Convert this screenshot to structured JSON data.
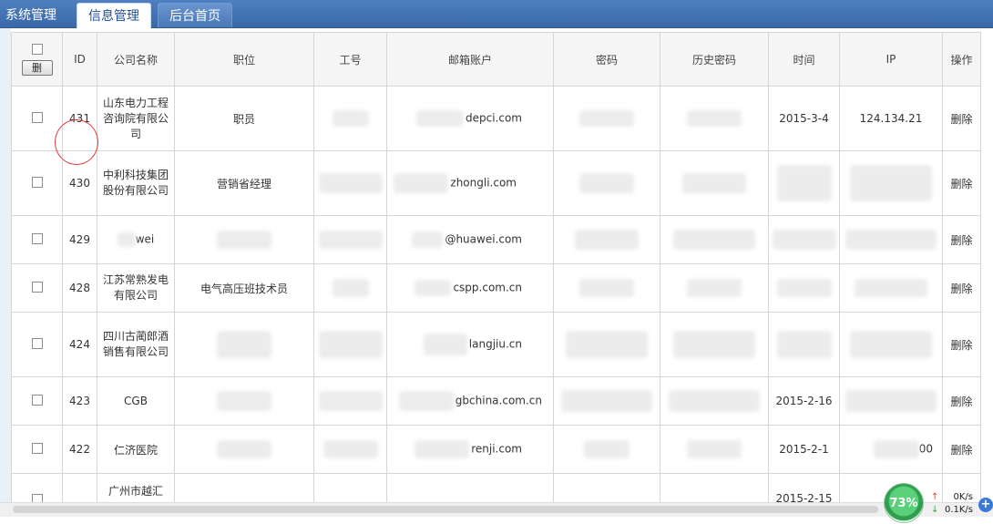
{
  "nav": {
    "tabs": [
      "系统管理",
      "信息管理",
      "后台首页"
    ]
  },
  "table": {
    "delete_button": "删",
    "columns": [
      "ID",
      "公司名称",
      "职位",
      "工号",
      "邮箱账户",
      "密码",
      "历史密码",
      "时间",
      "IP",
      "操作"
    ],
    "rows": [
      {
        "id": "431",
        "company": "山东电力工程咨询院有限公司",
        "position": "职员",
        "email": "depci.com",
        "time": "2015-3-4",
        "ip": "124.134.21",
        "op": "删除"
      },
      {
        "id": "430",
        "company": "中利科技集团股份有限公司",
        "position": "营销省经理",
        "email": "zhongli.com",
        "time": "",
        "ip": "",
        "op": "删除"
      },
      {
        "id": "429",
        "company": "wei",
        "position": "",
        "email": "@huawei.com",
        "time": "",
        "ip": "",
        "op": "删除"
      },
      {
        "id": "428",
        "company": "江苏常熟发电有限公司",
        "position": "电气高压班技术员",
        "email": "cspp.com.cn",
        "time": "",
        "ip": "",
        "op": "删除"
      },
      {
        "id": "424",
        "company": "四川古蔺郎酒销售有限公司",
        "position": "",
        "email": "langjiu.cn",
        "time": "",
        "ip": "",
        "op": "删除"
      },
      {
        "id": "423",
        "company": "CGB",
        "position": "",
        "email": "gbchina.com.cn",
        "time": "2015-2-16",
        "ip": "",
        "op": "删除"
      },
      {
        "id": "422",
        "company": "仁济医院",
        "position": "",
        "email": "renji.com",
        "time": "2015-2-1",
        "ip": "00",
        "op": "删除"
      },
      {
        "id": "",
        "company": "广州市越汇",
        "position": "",
        "email": "",
        "time": "2015-2-15",
        "ip": "",
        "op": ""
      }
    ]
  },
  "widget": {
    "percent": "73%",
    "up_speed": "0K/s",
    "down_speed": "0.1K/s"
  }
}
